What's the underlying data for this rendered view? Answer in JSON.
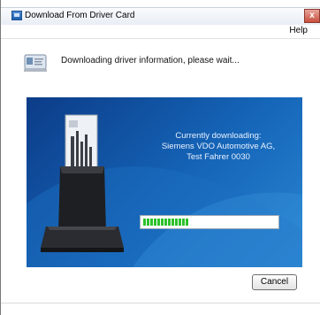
{
  "window": {
    "title": "Download From Driver Card",
    "close_glyph": "x"
  },
  "menu": {
    "items": [
      {
        "label": "Help"
      }
    ]
  },
  "status": {
    "message": "Downloading driver information, please wait..."
  },
  "download": {
    "heading": "Currently downloading:",
    "line1": "Siemens VDO Automotive AG,",
    "line2": "Test Fahrer 0030"
  },
  "progress": {
    "value_percent": 34
  },
  "buttons": {
    "cancel_label": "Cancel"
  },
  "icons": {
    "app": "app-icon",
    "card": "driver-card-icon",
    "reader": "card-reader-icon"
  },
  "colors": {
    "panel_dark": "#0c3c88",
    "panel_light": "#2b86d2",
    "progress_fill": "#2cc12c"
  }
}
